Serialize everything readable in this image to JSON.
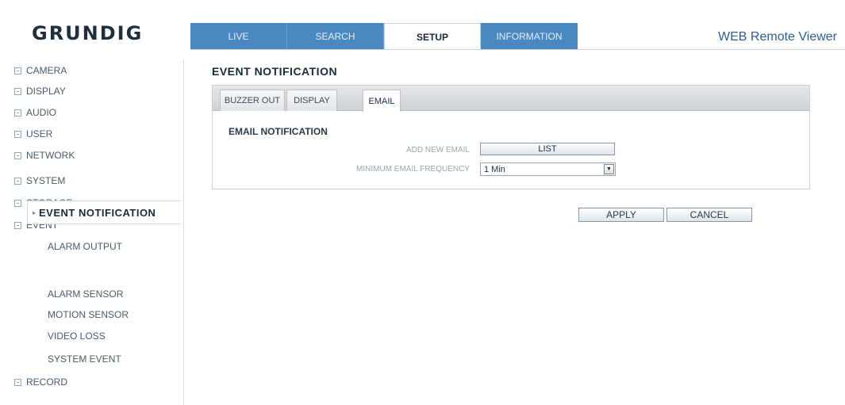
{
  "header": {
    "logo": "GRUNDIG",
    "app_title": "WEB Remote Viewer",
    "tabs": [
      {
        "label": "LIVE"
      },
      {
        "label": "SEARCH"
      },
      {
        "label": "SETUP"
      },
      {
        "label": "INFORMATION"
      }
    ],
    "active_tab": "SETUP"
  },
  "sidebar": {
    "items": [
      {
        "label": "CAMERA"
      },
      {
        "label": "DISPLAY"
      },
      {
        "label": "AUDIO"
      },
      {
        "label": "USER"
      },
      {
        "label": "NETWORK"
      },
      {
        "label": "SYSTEM"
      },
      {
        "label": "STORAGE"
      },
      {
        "label": "EVENT"
      },
      {
        "label": "RECORD"
      }
    ],
    "event_subitems": [
      {
        "label": "ALARM OUTPUT"
      },
      {
        "label": "EVENT NOTIFICATION"
      },
      {
        "label": "ALARM SENSOR"
      },
      {
        "label": "MOTION SENSOR"
      },
      {
        "label": "VIDEO LOSS"
      },
      {
        "label": "SYSTEM EVENT"
      }
    ]
  },
  "main": {
    "title": "EVENT NOTIFICATION",
    "subtabs": [
      {
        "label": "BUZZER OUT"
      },
      {
        "label": "DISPLAY"
      },
      {
        "label": "EMAIL"
      }
    ],
    "active_subtab": "EMAIL",
    "section_title": "EMAIL NOTIFICATION",
    "add_new_email_label": "ADD NEW EMAIL",
    "list_button": "LIST",
    "min_freq_label": "MINIMUM EMAIL FREQUENCY",
    "min_freq_value": "1 Min",
    "apply_button": "APPLY",
    "cancel_button": "CANCEL"
  },
  "colors": {
    "tab_bg": "#4a88c2",
    "app_title": "#2a5f97",
    "logo": "#1f2f3d"
  }
}
